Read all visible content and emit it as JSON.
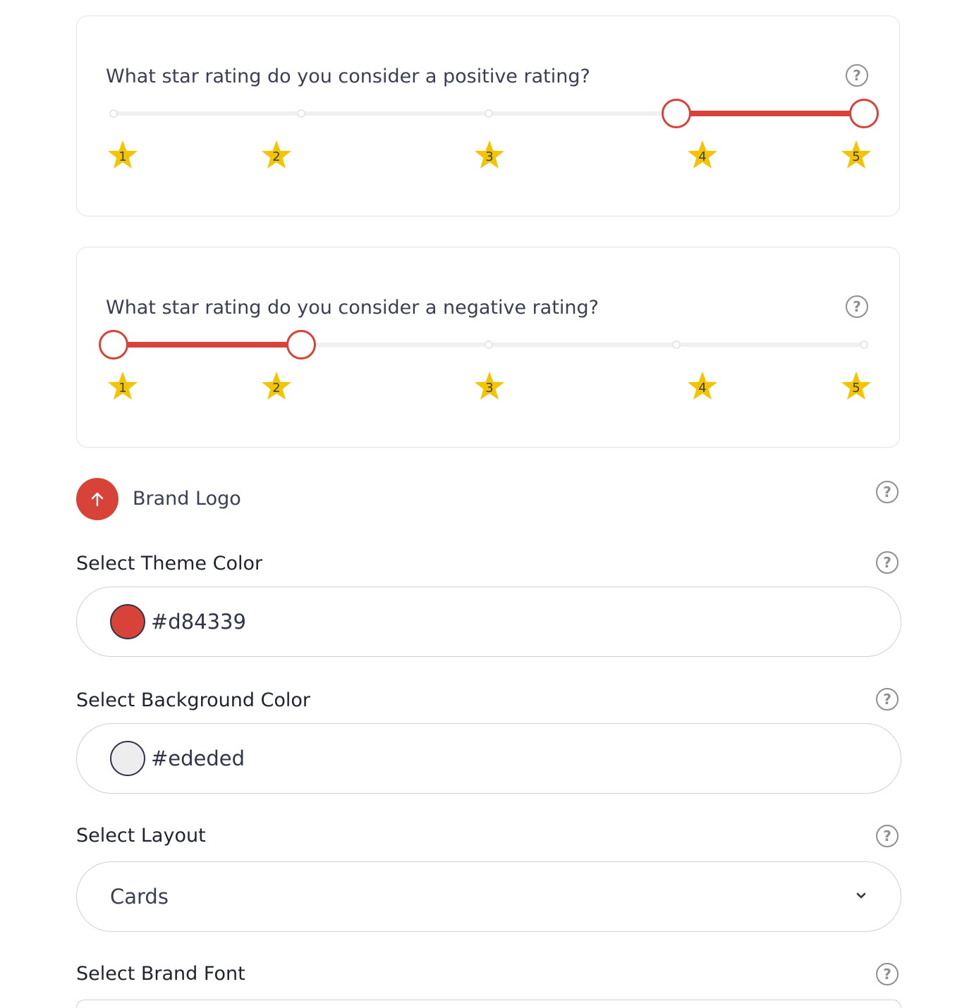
{
  "positive_rating": {
    "question": "What star rating do you consider a positive rating?",
    "stars": [
      "1",
      "2",
      "3",
      "4",
      "5"
    ],
    "range_min": 4,
    "range_max": 5
  },
  "negative_rating": {
    "question": "What star rating do you consider a negative rating?",
    "stars": [
      "1",
      "2",
      "3",
      "4",
      "5"
    ],
    "range_min": 1,
    "range_max": 2
  },
  "brand_logo": {
    "label": "Brand Logo"
  },
  "theme_color": {
    "label": "Select Theme Color",
    "value": "#d84339"
  },
  "background_color": {
    "label": "Select Background Color",
    "value": "#ededed"
  },
  "layout": {
    "label": "Select Layout",
    "selected": "Cards"
  },
  "brand_font": {
    "label": "Select Brand Font"
  },
  "help_glyph": "?",
  "colors": {
    "accent": "#d84339",
    "star": "#f5c400",
    "track": "#f0f0f0",
    "help": "#8e8e93"
  }
}
